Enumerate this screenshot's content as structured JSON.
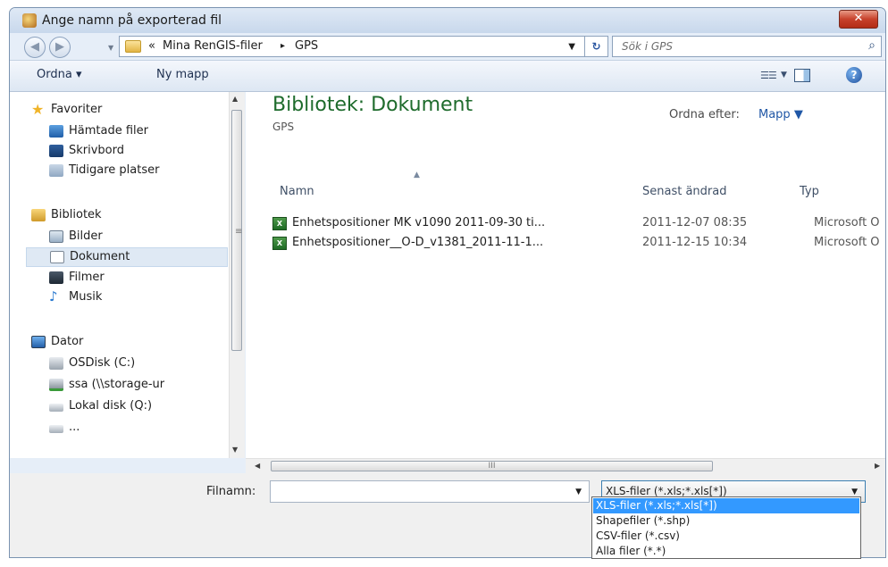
{
  "window": {
    "title": "Ange namn på exporterad fil",
    "close_label": "✕"
  },
  "nav": {
    "back": "◀",
    "forward": "▶",
    "drop": "▼",
    "path_prefix": "«",
    "path_parent": "Mina RenGIS-filer",
    "path_sep": "▸",
    "path_current": "GPS",
    "address_drop": "▼",
    "refresh": "↻",
    "search_placeholder": "Sök i GPS",
    "search_icon": "⌕"
  },
  "toolbar": {
    "organize": "Ordna ▾",
    "new_folder": "Ny mapp",
    "views_icon": "☰☰",
    "views_drop": "▼",
    "help": "?"
  },
  "sidebar": {
    "favorites": {
      "label": "Favoriter",
      "items": [
        "Hämtade filer",
        "Skrivbord",
        "Tidigare platser"
      ]
    },
    "libraries": {
      "label": "Bibliotek",
      "items": [
        "Bilder",
        "Dokument",
        "Filmer",
        "Musik"
      ],
      "selected": "Dokument"
    },
    "computer": {
      "label": "Dator",
      "items": [
        "OSDisk (C:)",
        "ssa (\\\\storage-ur",
        "Lokal disk (Q:)",
        "..."
      ]
    }
  },
  "scroll": {
    "up": "▲",
    "down": "▼",
    "grip": "≡",
    "left": "◀",
    "right": "▶",
    "hgrip": "III"
  },
  "content": {
    "library_title": "Bibliotek: Dokument",
    "library_subtitle": "GPS",
    "sort_label": "Ordna efter:",
    "sort_value": "Mapp ▼",
    "sort_arrow": "▲",
    "columns": {
      "name": "Namn",
      "date": "Senast ändrad",
      "type": "Typ"
    },
    "files": [
      {
        "name": "Enhetspositioner  MK v1090 2011-09-30 ti...",
        "date": "2011-12-07 08:35",
        "type": "Microsoft O"
      },
      {
        "name": "Enhetspositioner__O-D_v1381_2011-11-1...",
        "date": "2011-12-15 10:34",
        "type": "Microsoft O"
      }
    ],
    "file_icon": "X"
  },
  "bottom": {
    "filename_label": "Filnamn:",
    "filename_value": "",
    "filename_drop": "▼",
    "filetype_value": "XLS-filer (*.xls;*.xls[*])",
    "filetype_drop": "▼",
    "filetype_options": [
      "XLS-filer (*.xls;*.xls[*])",
      "Shapefiler (*.shp)",
      "CSV-filer (*.csv)",
      "Alla filer (*.*)"
    ]
  }
}
